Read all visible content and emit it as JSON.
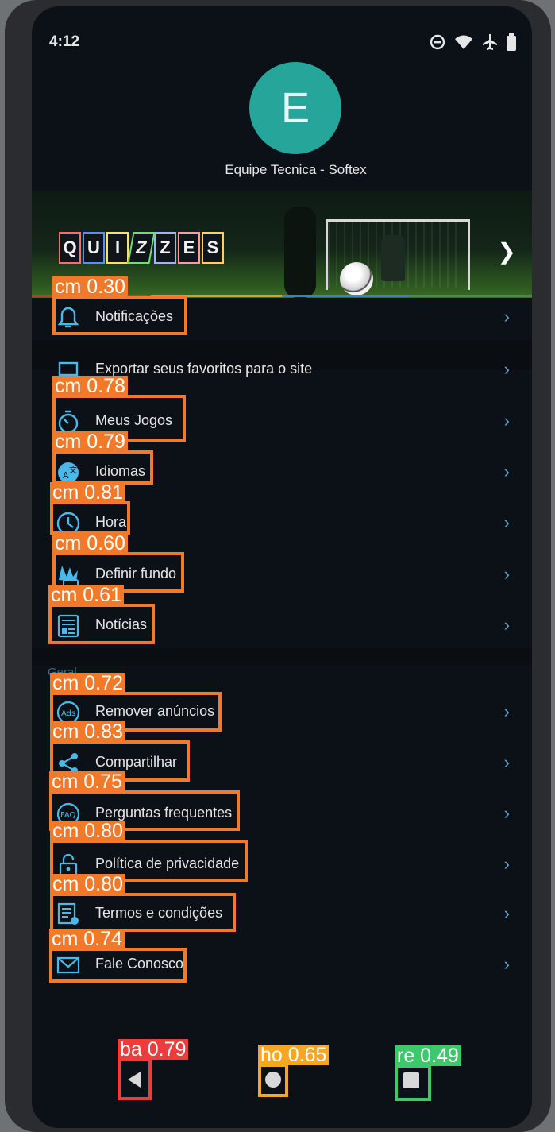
{
  "status_bar": {
    "time": "4:12",
    "icons": [
      "do-not-disturb-icon",
      "wifi-icon",
      "airplane-icon",
      "battery-icon"
    ]
  },
  "profile": {
    "initial": "E",
    "name": "Equipe Tecnica - Softex"
  },
  "banner": {
    "letters": [
      "Q",
      "U",
      "I",
      "Z",
      "Z",
      "E",
      "S"
    ],
    "quiz_logo_label": "QUIZZES"
  },
  "menu": [
    {
      "label": "Notificações",
      "icon": "bell-icon"
    },
    {
      "label": "Exportar seus favoritos para o site",
      "icon": "laptop-icon"
    },
    {
      "label": "Meus Jogos",
      "icon": "stopwatch-icon"
    },
    {
      "label": "Idiomas",
      "icon": "language-icon"
    },
    {
      "label": "Hora",
      "icon": "clock-icon"
    },
    {
      "label": "Definir fundo",
      "icon": "wallpaper-icon"
    },
    {
      "label": "Notícias",
      "icon": "news-icon"
    }
  ],
  "section_general": {
    "title": "Geral"
  },
  "general": [
    {
      "label": "Remover anúncios",
      "icon": "ads-icon"
    },
    {
      "label": "Compartilhar",
      "icon": "share-icon"
    },
    {
      "label": "Perguntas frequentes",
      "icon": "faq-icon"
    },
    {
      "label": "Política de privacidade",
      "icon": "lock-icon"
    },
    {
      "label": "Termos e condições",
      "icon": "terms-icon"
    },
    {
      "label": "Fale Conosco",
      "icon": "mail-icon"
    }
  ],
  "detections": [
    "cm 0.30",
    "cm 0.78",
    "cm 0.79",
    "cm 0.81",
    "cm 0.60",
    "cm 0.61",
    "cm 0.72",
    "cm 0.83",
    "cm 0.75",
    "cm 0.80",
    "cm 0.80",
    "cm 0.74",
    "ba 0.79",
    "ho 0.65",
    "re 0.49"
  ],
  "nav": {
    "back": "back-icon",
    "home": "home-icon",
    "recents": "recents-icon"
  },
  "colors": {
    "accent": "#4ab8e8",
    "avatar": "#26a69a",
    "detection": "#f07a2a"
  }
}
